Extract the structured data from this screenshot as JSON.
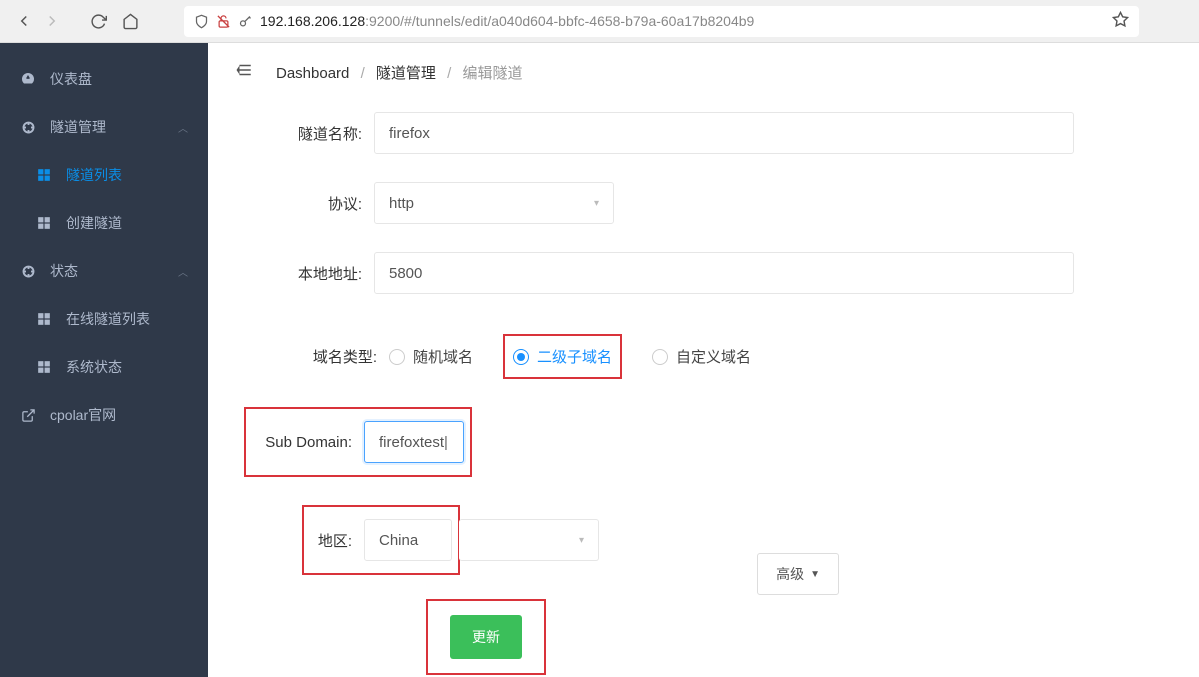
{
  "browser": {
    "url_host": "192.168.206.128",
    "url_rest": ":9200/#/tunnels/edit/a040d604-bbfc-4658-b79a-60a17b8204b9"
  },
  "sidebar": {
    "dashboard": "仪表盘",
    "tunnel_mgmt": "隧道管理",
    "tunnel_list": "隧道列表",
    "tunnel_create": "创建隧道",
    "status": "状态",
    "online_list": "在线隧道列表",
    "sys_status": "系统状态",
    "cpolar": "cpolar官网"
  },
  "breadcrumb": {
    "a": "Dashboard",
    "b": "隧道管理",
    "c": "编辑隧道"
  },
  "labels": {
    "name": "隧道名称:",
    "proto": "协议:",
    "addr": "本地地址:",
    "dtype": "域名类型:",
    "subdomain": "Sub Domain:",
    "region": "地区:"
  },
  "values": {
    "name": "firefox",
    "proto": "http",
    "addr": "5800",
    "subdomain": "firefoxtest",
    "region": "China"
  },
  "radio": {
    "r1": "随机域名",
    "r2": "二级子域名",
    "r3": "自定义域名"
  },
  "buttons": {
    "advanced": "高级",
    "update": "更新"
  }
}
